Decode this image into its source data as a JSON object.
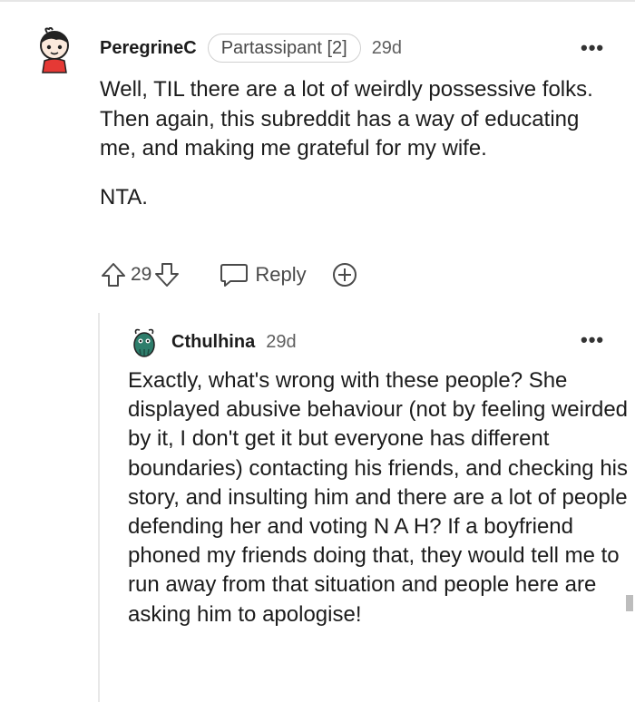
{
  "comment": {
    "username": "PeregrineC",
    "flair": "Partassipant [2]",
    "age": "29d",
    "more": "•••",
    "paragraphs": [
      "Well, TIL there are a lot of weirdly possessive folks. Then again, this subreddit has a way of educating me, and making me grateful for my wife.",
      "NTA."
    ],
    "votes": "29",
    "reply_label": "Reply",
    "icons": [
      "upvote-icon",
      "downvote-icon",
      "reply-bubble-icon",
      "award-icon",
      "more-options-icon"
    ]
  },
  "reply": {
    "username": "Cthulhina",
    "age": "29d",
    "more": "•••",
    "text": "Exactly, what's wrong with these people? She displayed abusive behaviour (not by feeling weirded by it, I don't get it but everyone has different boundaries) contacting his friends, and checking his story, and insulting him and there are a lot of people defending her and voting N A H? If a boyfriend phoned my friends doing that, they would tell me to run away from that situation and people here are asking him to apologise!"
  },
  "colors": {
    "text": "#1c1c1c",
    "muted": "#4a4a4a",
    "avatar_shirt": "#e53935",
    "avatar2_body": "#2e7d6b"
  }
}
